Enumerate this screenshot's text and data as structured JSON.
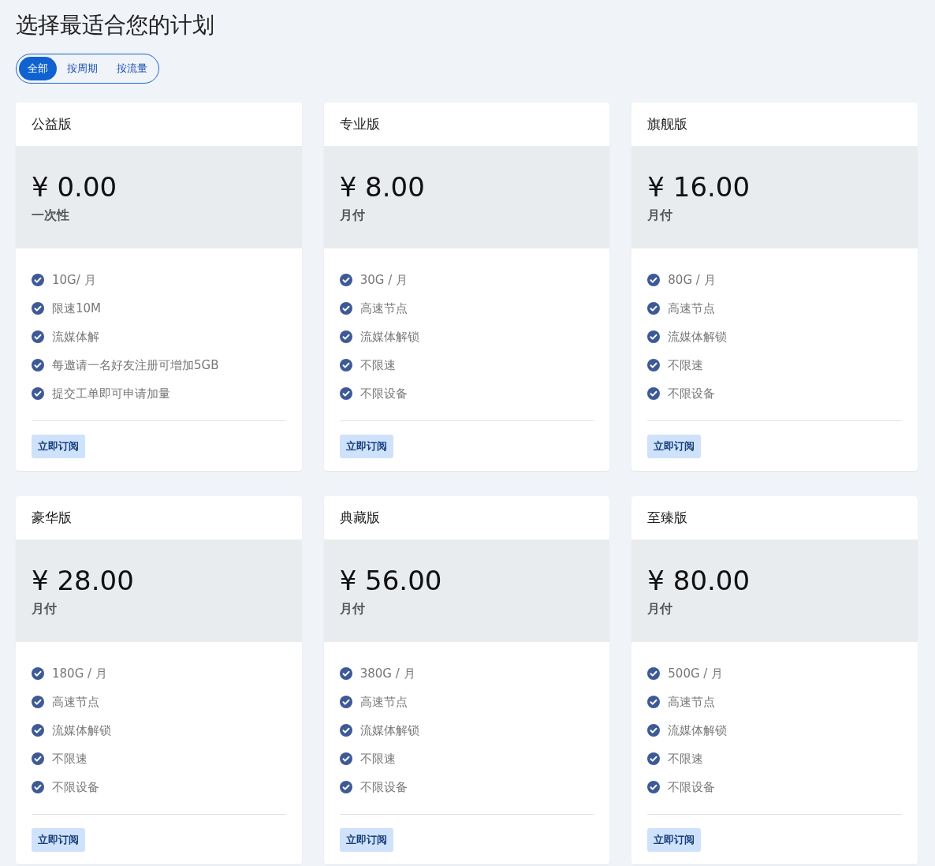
{
  "title": "选择最适合您的计划",
  "tabs": [
    {
      "label": "全部",
      "selected": true
    },
    {
      "label": "按周期",
      "selected": false
    },
    {
      "label": "按流量",
      "selected": false
    }
  ],
  "plans": [
    {
      "name": "公益版",
      "price": "¥ 0.00",
      "period": "一次性",
      "features": [
        "10G/ 月",
        "限速10M",
        "流媒体解",
        "每邀请一名好友注册可增加5GB",
        "提交工单即可申请加量"
      ],
      "button": "立即订阅"
    },
    {
      "name": "专业版",
      "price": "¥ 8.00",
      "period": "月付",
      "features": [
        "30G / 月",
        "高速节点",
        "流媒体解锁",
        "不限速",
        "不限设备"
      ],
      "button": "立即订阅"
    },
    {
      "name": "旗舰版",
      "price": "¥ 16.00",
      "period": "月付",
      "features": [
        "80G / 月",
        "高速节点",
        "流媒体解锁",
        "不限速",
        "不限设备"
      ],
      "button": "立即订阅"
    },
    {
      "name": "豪华版",
      "price": "¥ 28.00",
      "period": "月付",
      "features": [
        "180G / 月",
        "高速节点",
        "流媒体解锁",
        "不限速",
        "不限设备"
      ],
      "button": "立即订阅"
    },
    {
      "name": "典藏版",
      "price": "¥ 56.00",
      "period": "月付",
      "features": [
        "380G / 月",
        "高速节点",
        "流媒体解锁",
        "不限速",
        "不限设备"
      ],
      "button": "立即订阅"
    },
    {
      "name": "至臻版",
      "price": "¥ 80.00",
      "period": "月付",
      "features": [
        "500G / 月",
        "高速节点",
        "流媒体解锁",
        "不限速",
        "不限设备"
      ],
      "button": "立即订阅"
    }
  ]
}
